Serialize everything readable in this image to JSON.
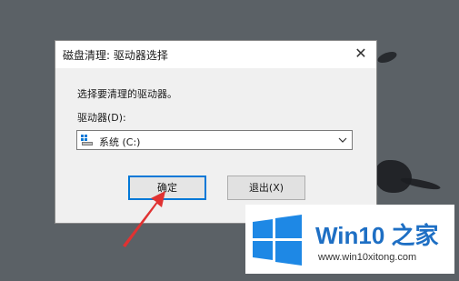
{
  "dialog": {
    "title": "磁盘清理: 驱动器选择",
    "close_label": "✕",
    "prompt": "选择要清理的驱动器。",
    "drive_label": "驱动器(D):",
    "selected_drive": "系统 (C:)",
    "ok_label": "确定",
    "exit_label": "退出(X)"
  },
  "logo": {
    "brand_text": "Win10 之家",
    "url": "www.win10xitong.com"
  },
  "colors": {
    "accent": "#0078d7",
    "annotation_arrow": "#e03232",
    "logo_blue": "#1e6fc4"
  }
}
